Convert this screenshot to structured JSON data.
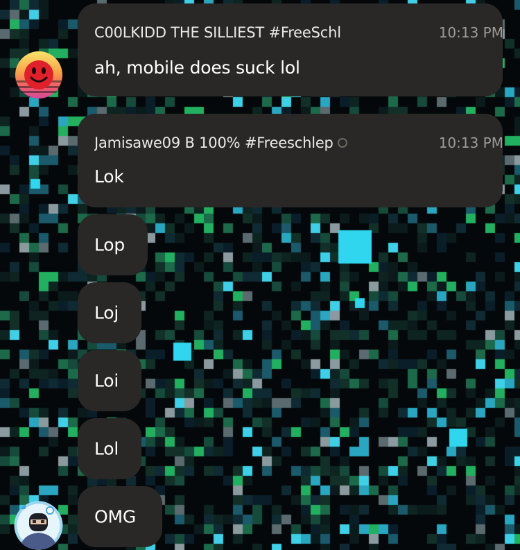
{
  "messages": [
    {
      "sender": "C00LKIDD THE SILLIEST #FreeSchl",
      "time": "10:13 PM",
      "text": "ah, mobile does suck lol",
      "avatar": "smiley-face-avatar"
    },
    {
      "sender": "Jamisawe09 B 100% #Freeschlep",
      "time": "10:13 PM",
      "text": "Lok",
      "avatar": ""
    }
  ],
  "followups": [
    "Lop",
    "Loj",
    "Loi",
    "Lol",
    "OMG"
  ],
  "colors": {
    "bubble": "#2a2826",
    "timestamp": "#9d9a97",
    "background": "#05080a"
  },
  "icons": {
    "first_avatar": "red-smiley-avatar",
    "last_avatar": "ninja-character-avatar"
  }
}
